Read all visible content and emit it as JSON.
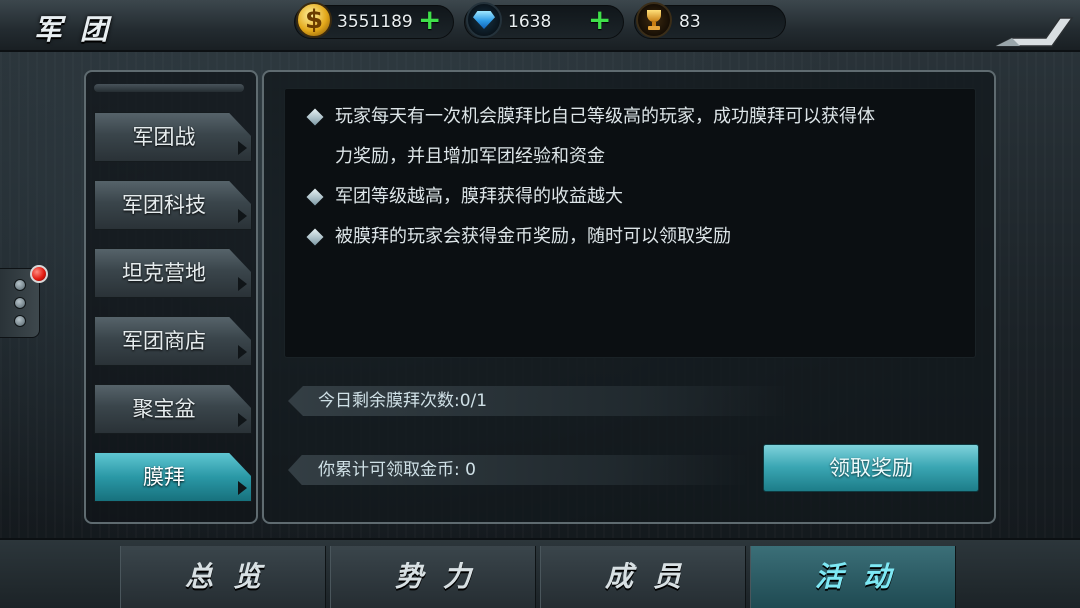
{
  "header": {
    "title": "军团",
    "gold": "3551189",
    "gems": "1638",
    "trophies": "83"
  },
  "menu": {
    "items": [
      {
        "label": "军团战",
        "active": false
      },
      {
        "label": "军团科技",
        "active": false
      },
      {
        "label": "坦克营地",
        "active": false
      },
      {
        "label": "军团商店",
        "active": false
      },
      {
        "label": "聚宝盆",
        "active": false
      },
      {
        "label": "膜拜",
        "active": true
      }
    ]
  },
  "description": {
    "line1": "玩家每天有一次机会膜拜比自己等级高的玩家，成功膜拜可以获得体",
    "line1b": "力奖励，并且增加军团经验和资金",
    "line2": "军团等级越高，膜拜获得的收益越大",
    "line3": "被膜拜的玩家会获得金币奖励，随时可以领取奖励"
  },
  "status": {
    "remaining": "今日剩余膜拜次数:0/1",
    "claimable": "你累计可领取金币: 0"
  },
  "claim_button": "领取奖励",
  "tabs": [
    {
      "label": "总览",
      "active": false
    },
    {
      "label": "势力",
      "active": false
    },
    {
      "label": "成员",
      "active": false
    },
    {
      "label": "活动",
      "active": true
    }
  ],
  "colors": {
    "accent": "#2a98a6",
    "plus": "#3fe04a",
    "notification": "#e21c12"
  }
}
